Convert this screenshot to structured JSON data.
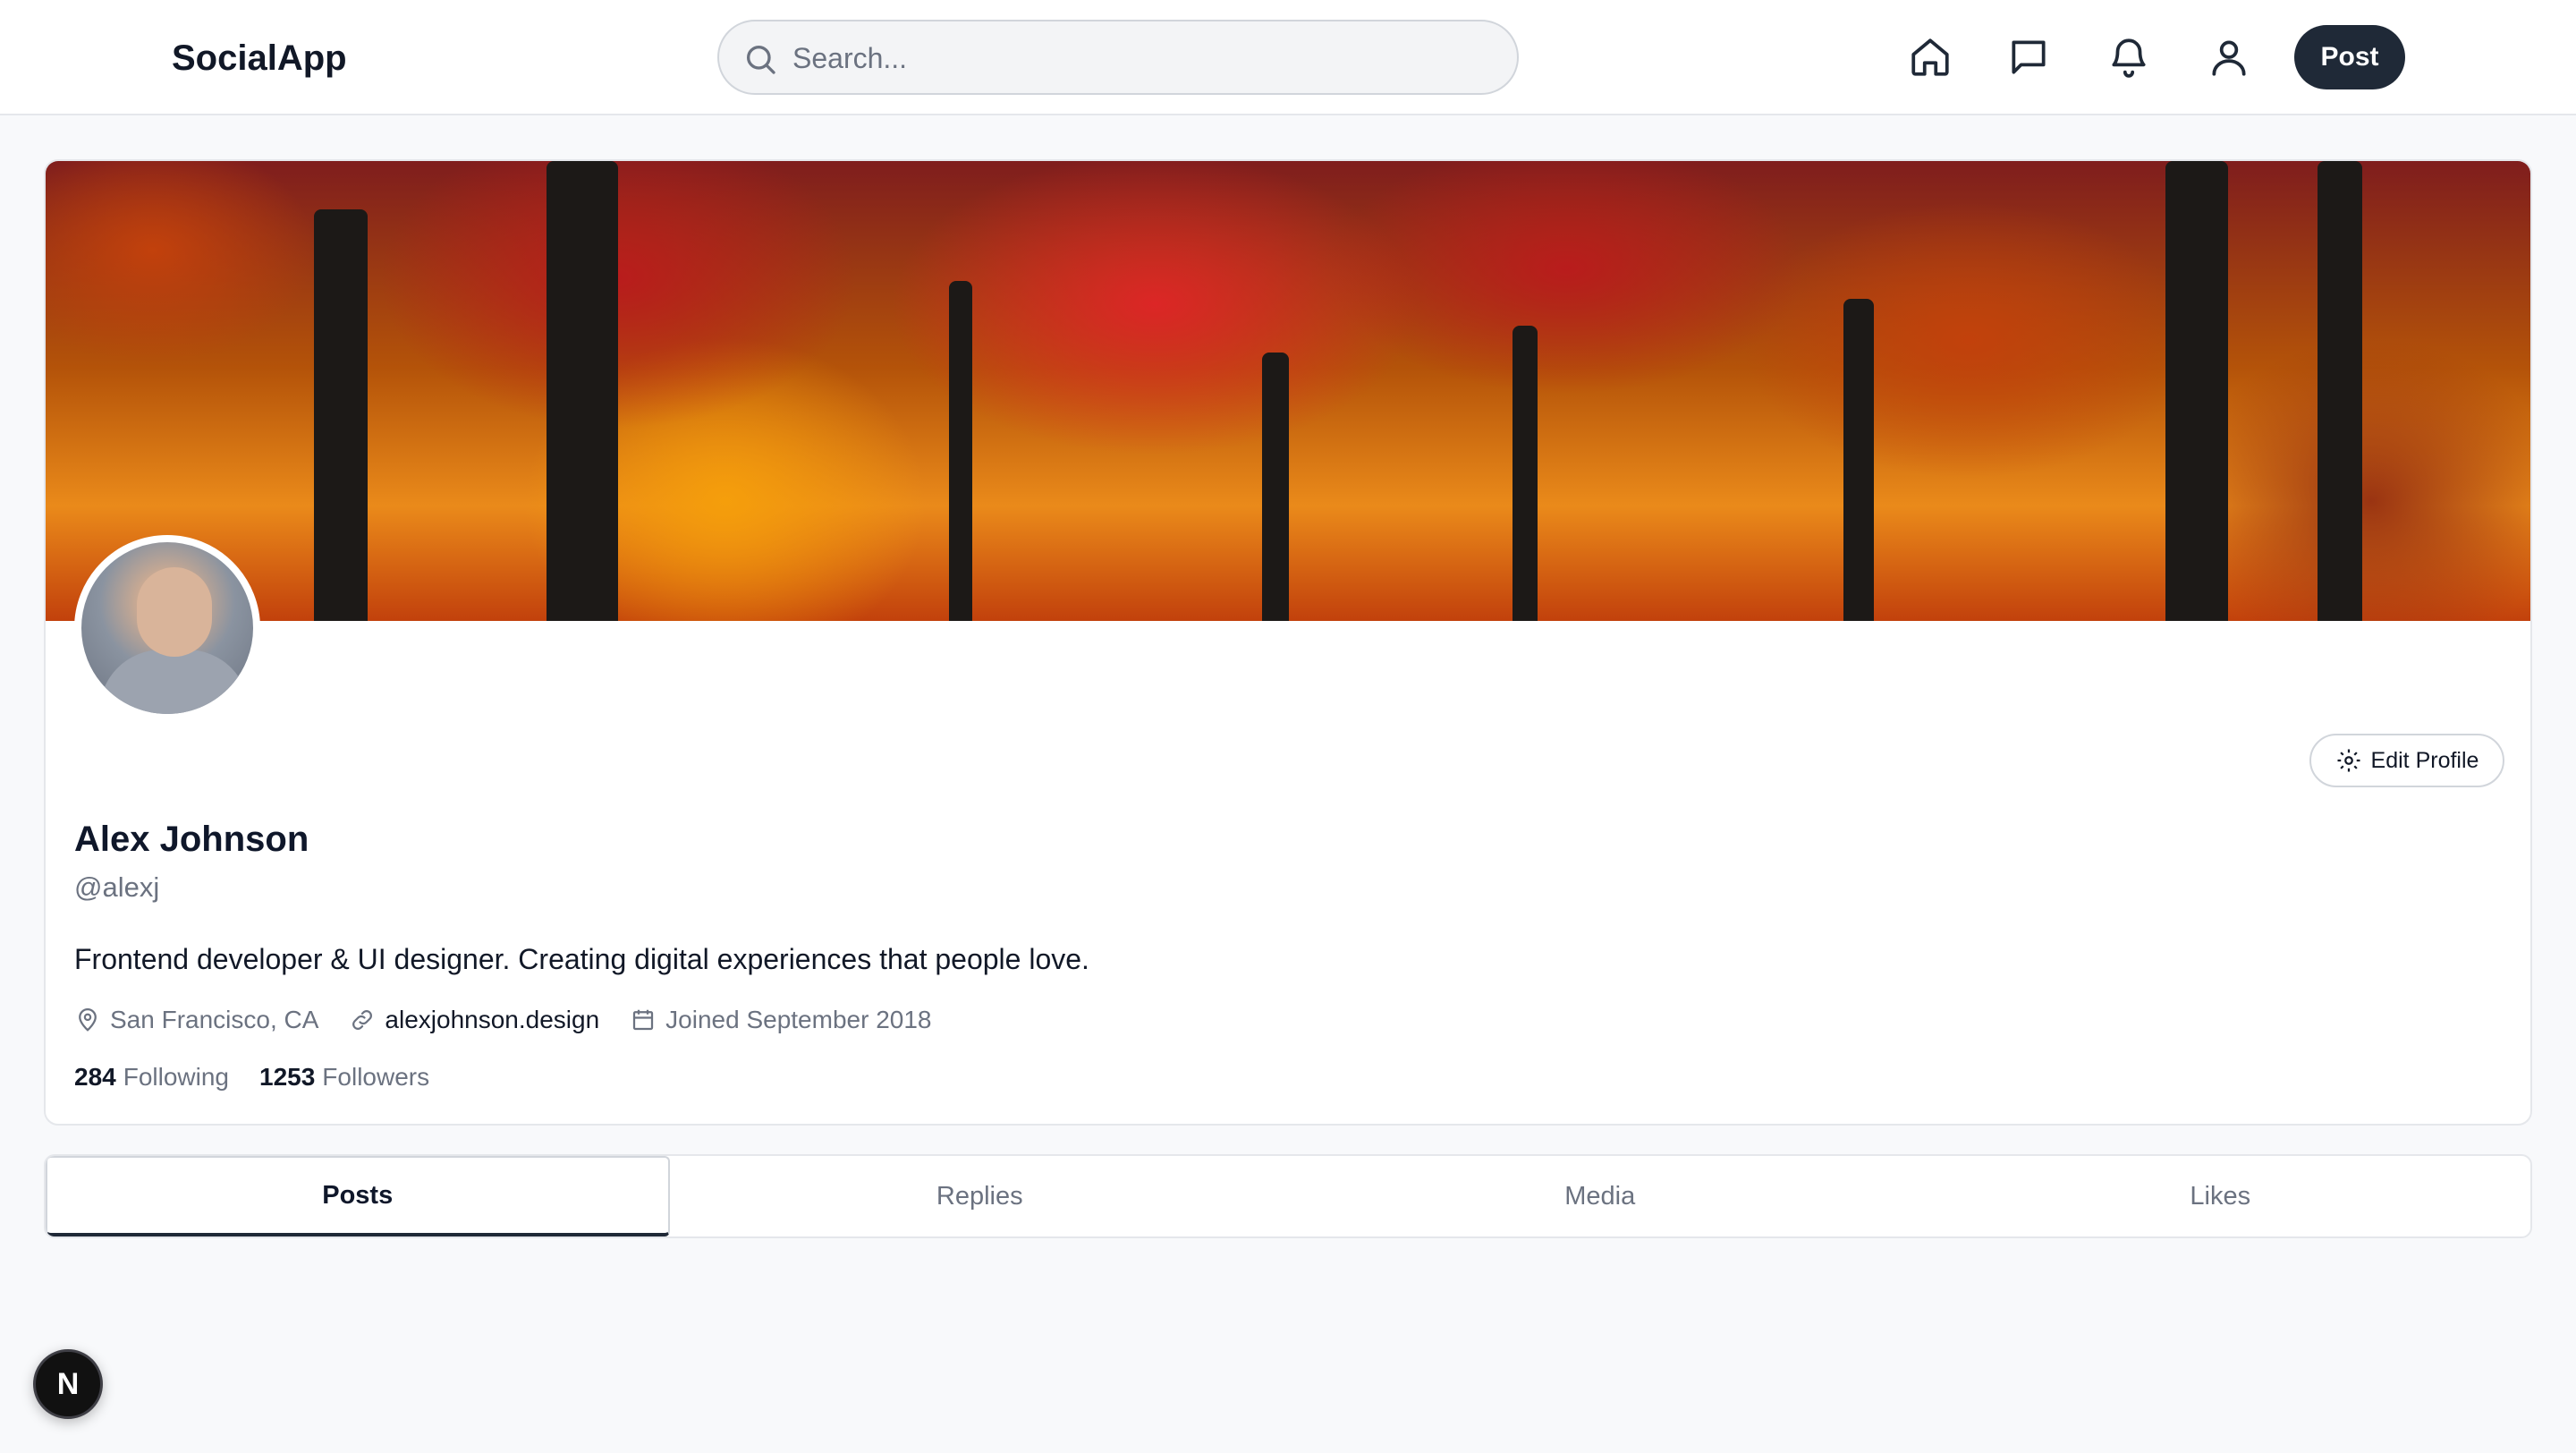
{
  "header": {
    "brand": "SocialApp",
    "search_placeholder": "Search...",
    "nav_icons": [
      "home-icon",
      "message-icon",
      "bell-icon",
      "user-icon"
    ],
    "post_label": "Post"
  },
  "profile": {
    "name": "Alex Johnson",
    "handle": "@alexj",
    "bio": "Frontend developer & UI designer. Creating digital experiences that people love.",
    "location": "San Francisco, CA",
    "website": "alexjohnson.design",
    "joined": "Joined September 2018",
    "following_count": "284",
    "following_label": "Following",
    "followers_count": "1253",
    "followers_label": "Followers",
    "edit_label": "Edit Profile"
  },
  "tabs": [
    {
      "label": "Posts",
      "active": true
    },
    {
      "label": "Replies",
      "active": false
    },
    {
      "label": "Media",
      "active": false
    },
    {
      "label": "Likes",
      "active": false
    }
  ],
  "badge": {
    "letter": "N"
  },
  "colors": {
    "primary": "#1f2937",
    "muted_text": "#6b7280",
    "border": "#e5e7eb",
    "background": "#f8f9fb"
  }
}
